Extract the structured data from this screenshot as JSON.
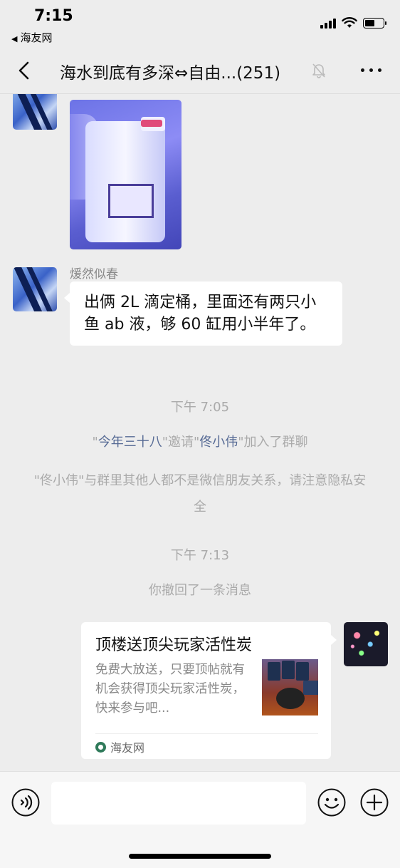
{
  "status_bar": {
    "time": "7:15",
    "back_app": "海友网",
    "icons": [
      "signal-icon",
      "wifi-icon",
      "battery-icon"
    ]
  },
  "nav": {
    "title": "海水到底有多深⇔自由...(251)",
    "back_icon": "chevron-left-icon",
    "mute_icon": "bell-muted-icon",
    "more_icon": "more-icon"
  },
  "messages": [
    {
      "type": "image",
      "sender": "",
      "image_desc_icon": "reagent-bottle-photo"
    },
    {
      "type": "text",
      "sender": "煖然似春",
      "text": "出俩 2L 滴定桶，里面还有两只小鱼 ab 液，够 60 缸用小半年了。"
    }
  ],
  "system": {
    "time_1": "下午 7:05",
    "invite_q1": "\"",
    "inviter": "今年三十八",
    "invite_mid": "\"邀请\"",
    "invitee": "佟小伟",
    "invite_end": "\"加入了群聊",
    "warning": "\"佟小伟\"与群里其他人都不是微信朋友关系，请注意隐私安全",
    "time_2": "下午 7:13",
    "recalled": "你撤回了一条消息"
  },
  "link_card": {
    "title": "顶楼送顶尖玩家活性炭",
    "description": "免费大放送，只要顶帖就有机会获得顶尖玩家活性炭，快来参与吧...",
    "source": "海友网"
  },
  "input": {
    "value": "",
    "placeholder": "",
    "voice_icon": "voice-icon",
    "emoji_icon": "emoji-icon",
    "plus_icon": "plus-icon"
  },
  "colors": {
    "background": "#ededed",
    "link_name": "#576b95",
    "system_text": "#aaaaaa",
    "bubble": "#ffffff"
  }
}
